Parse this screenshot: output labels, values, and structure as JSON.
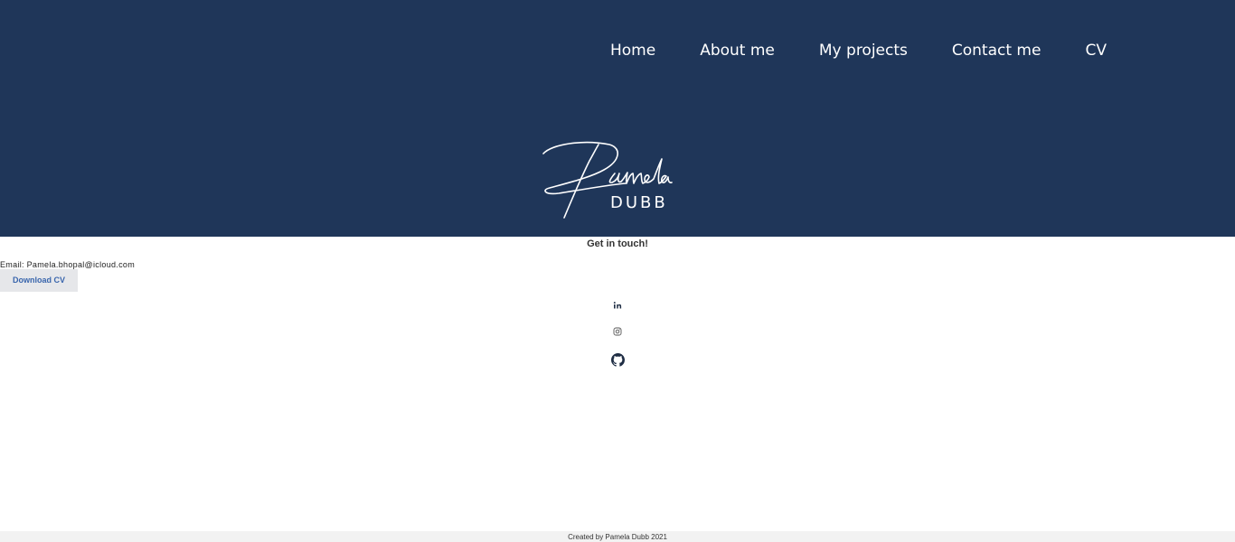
{
  "nav": {
    "items": [
      {
        "label": "Home"
      },
      {
        "label": "About me"
      },
      {
        "label": "My projects"
      },
      {
        "label": "Contact me"
      },
      {
        "label": "CV"
      }
    ]
  },
  "logo": {
    "script_text": "Pamela",
    "subtext": "DUBB"
  },
  "contact": {
    "heading": "Get in touch!",
    "email_line": "Email: Pamela.bhopal@icloud.com",
    "download_label": "Download CV"
  },
  "social": {
    "icons": [
      "linkedin-icon",
      "instagram-icon",
      "github-icon"
    ]
  },
  "footer": {
    "text": "Created by Pamela Dubb 2021"
  },
  "colors": {
    "header_bg": "#1f3659",
    "text_on_header": "#ffffff",
    "button_bg": "#e6e7ea",
    "button_text": "#3a66ad",
    "footer_bg": "#f2f2f2"
  }
}
